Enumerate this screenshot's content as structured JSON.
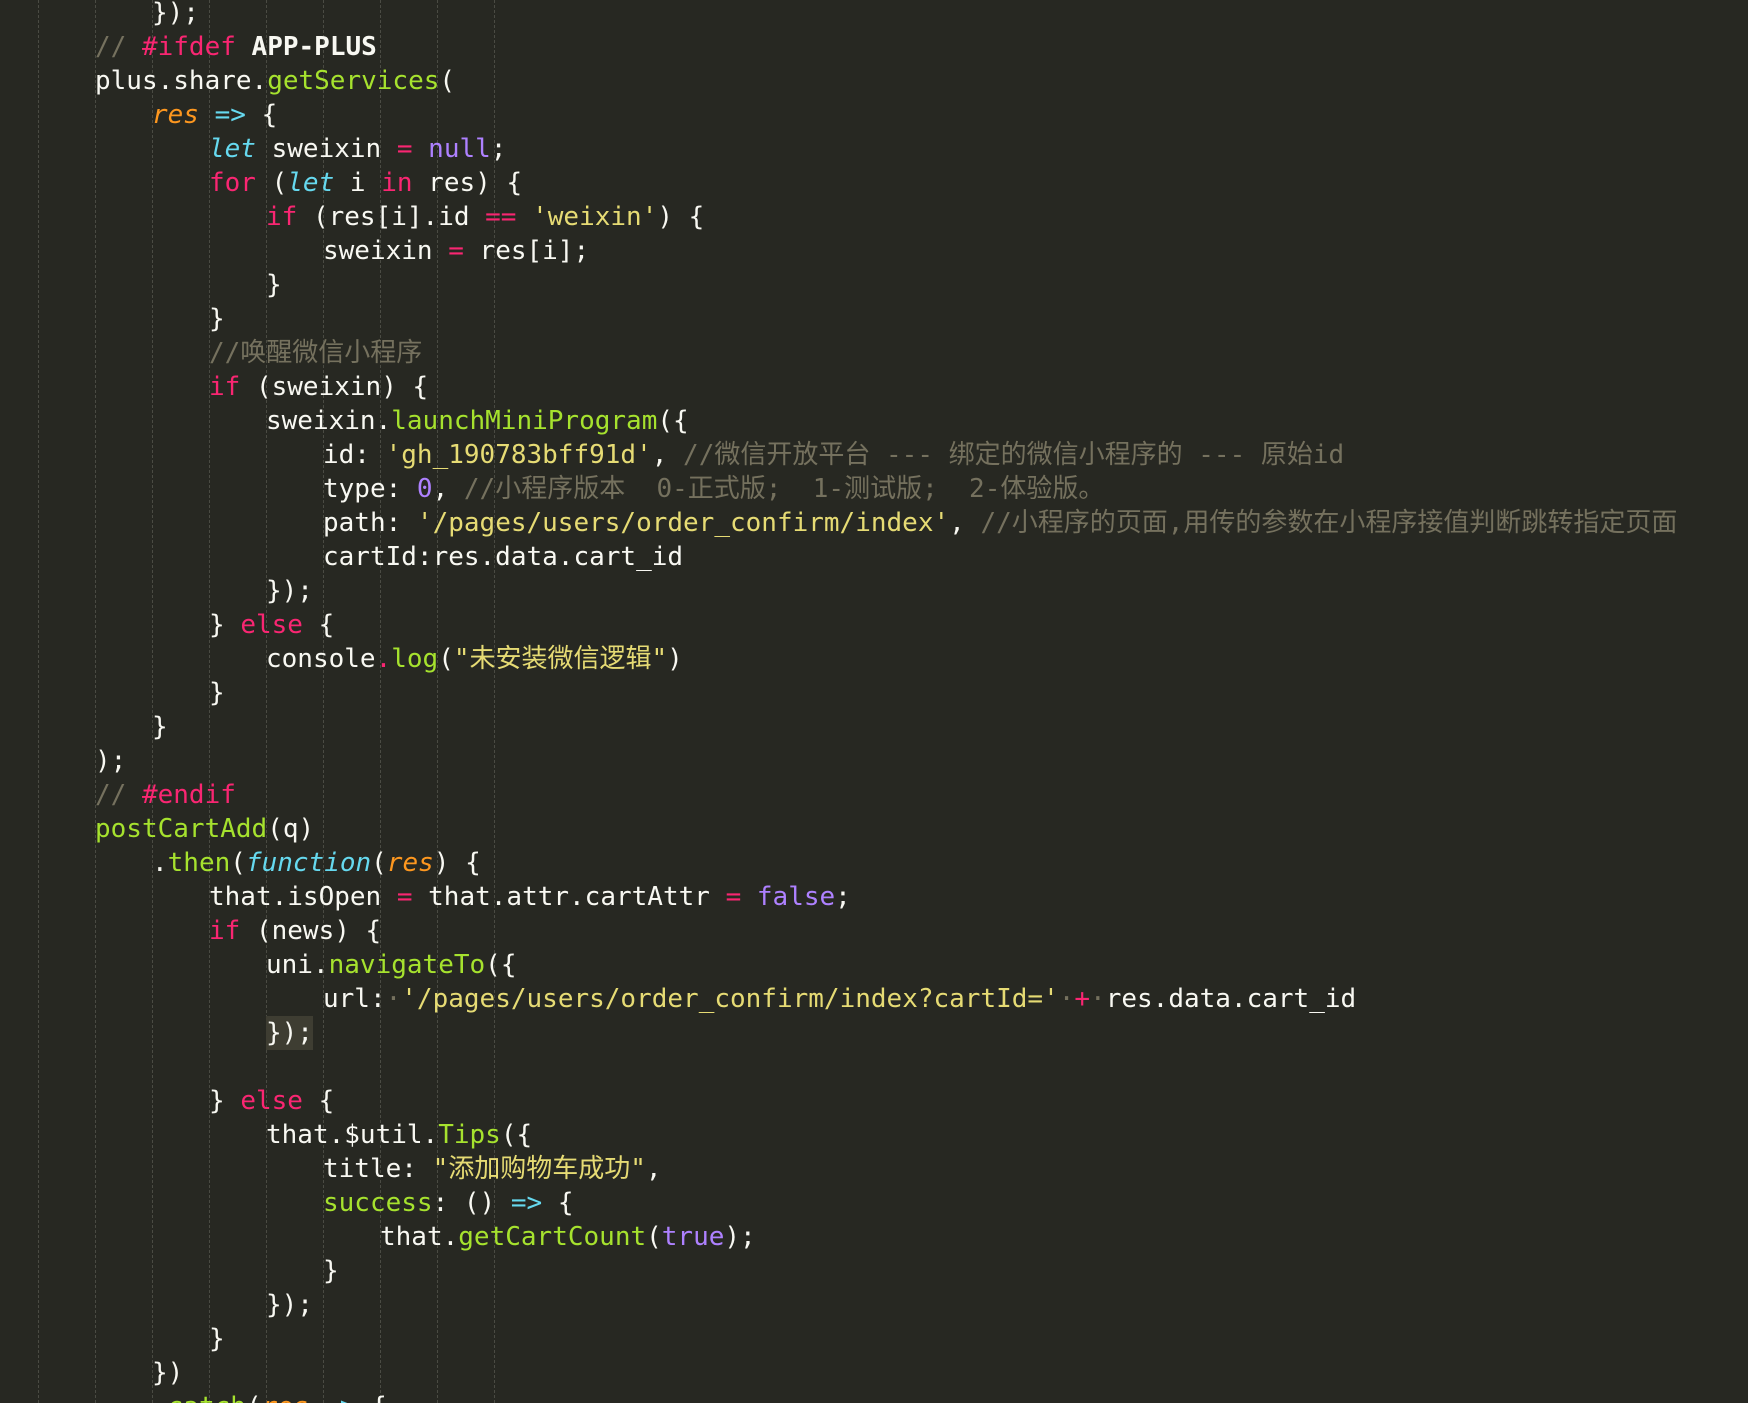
{
  "editor": {
    "theme": "monokai",
    "colors": {
      "background": "#272822",
      "plain": "#f8f8f2",
      "keyword": "#f92672",
      "storage": "#66d9ef",
      "param": "#fd971f",
      "function": "#a6e22e",
      "string": "#e6db74",
      "number": "#ae81ff",
      "comment": "#75715e",
      "highlight": "#3e3d32"
    },
    "highlighted_line": 30,
    "lines": [
      {
        "indent": 4,
        "tokens": [
          [
            "plain",
            "});"
          ]
        ]
      },
      {
        "indent": 3,
        "tokens": [
          [
            "comment",
            "// "
          ],
          [
            "directive",
            "#ifdef "
          ],
          [
            "bold",
            "APP-PLUS"
          ]
        ]
      },
      {
        "indent": 3,
        "tokens": [
          [
            "plain",
            "plus.share."
          ],
          [
            "func",
            "getServices"
          ],
          [
            "plain",
            "("
          ]
        ]
      },
      {
        "indent": 4,
        "tokens": [
          [
            "param",
            "res"
          ],
          [
            "plain",
            " "
          ],
          [
            "storage",
            "=>"
          ],
          [
            "plain",
            " {"
          ]
        ]
      },
      {
        "indent": 5,
        "tokens": [
          [
            "storage",
            "let"
          ],
          [
            "plain",
            " sweixin "
          ],
          [
            "op",
            "="
          ],
          [
            "plain",
            " "
          ],
          [
            "const",
            "null"
          ],
          [
            "plain",
            ";"
          ]
        ]
      },
      {
        "indent": 5,
        "tokens": [
          [
            "keyword",
            "for"
          ],
          [
            "plain",
            " ("
          ],
          [
            "storage",
            "let"
          ],
          [
            "plain",
            " i "
          ],
          [
            "keyword",
            "in"
          ],
          [
            "plain",
            " res) {"
          ]
        ]
      },
      {
        "indent": 6,
        "tokens": [
          [
            "keyword",
            "if"
          ],
          [
            "plain",
            " (res[i].id "
          ],
          [
            "op",
            "=="
          ],
          [
            "plain",
            " "
          ],
          [
            "string",
            "'weixin'"
          ],
          [
            "plain",
            ") {"
          ]
        ]
      },
      {
        "indent": 7,
        "tokens": [
          [
            "plain",
            "sweixin "
          ],
          [
            "op",
            "="
          ],
          [
            "plain",
            " res[i];"
          ]
        ]
      },
      {
        "indent": 6,
        "tokens": [
          [
            "plain",
            "}"
          ]
        ]
      },
      {
        "indent": 5,
        "tokens": [
          [
            "plain",
            "}"
          ]
        ]
      },
      {
        "indent": 5,
        "tokens": [
          [
            "comment",
            "//唤醒微信小程序"
          ]
        ]
      },
      {
        "indent": 5,
        "tokens": [
          [
            "keyword",
            "if"
          ],
          [
            "plain",
            " (sweixin) {"
          ]
        ]
      },
      {
        "indent": 6,
        "tokens": [
          [
            "plain",
            "sweixin."
          ],
          [
            "func",
            "launchMiniProgram"
          ],
          [
            "plain",
            "({"
          ]
        ]
      },
      {
        "indent": 7,
        "tokens": [
          [
            "plain",
            "id: "
          ],
          [
            "string",
            "'gh_190783bff91d'"
          ],
          [
            "plain",
            ", "
          ],
          [
            "comment",
            "//微信开放平台 --- 绑定的微信小程序的 --- 原始id"
          ]
        ]
      },
      {
        "indent": 7,
        "tokens": [
          [
            "plain",
            "type: "
          ],
          [
            "number",
            "0"
          ],
          [
            "plain",
            ", "
          ],
          [
            "comment",
            "//小程序版本  0-正式版;  1-测试版;  2-体验版。"
          ]
        ]
      },
      {
        "indent": 7,
        "tokens": [
          [
            "plain",
            "path: "
          ],
          [
            "string",
            "'/pages/users/order_confirm/index'"
          ],
          [
            "plain",
            ", "
          ],
          [
            "comment",
            "//小程序的页面,用传的参数在小程序接值判断跳转指定页面"
          ]
        ]
      },
      {
        "indent": 7,
        "tokens": [
          [
            "plain",
            "cartId:res.data.cart_id"
          ]
        ]
      },
      {
        "indent": 6,
        "tokens": [
          [
            "plain",
            "});"
          ]
        ]
      },
      {
        "indent": 5,
        "tokens": [
          [
            "plain",
            "} "
          ],
          [
            "keyword",
            "else"
          ],
          [
            "plain",
            " {"
          ]
        ]
      },
      {
        "indent": 6,
        "tokens": [
          [
            "plain",
            "console"
          ],
          [
            "op",
            "."
          ],
          [
            "func",
            "log"
          ],
          [
            "plain",
            "("
          ],
          [
            "string",
            "\"未安装微信逻辑\""
          ],
          [
            "plain",
            ")"
          ]
        ]
      },
      {
        "indent": 5,
        "tokens": [
          [
            "plain",
            "}"
          ]
        ]
      },
      {
        "indent": 4,
        "tokens": [
          [
            "plain",
            "}"
          ]
        ]
      },
      {
        "indent": 3,
        "tokens": [
          [
            "plain",
            ");"
          ]
        ]
      },
      {
        "indent": 3,
        "tokens": [
          [
            "comment",
            "// "
          ],
          [
            "directive",
            "#endif"
          ]
        ]
      },
      {
        "indent": 3,
        "tokens": [
          [
            "func",
            "postCartAdd"
          ],
          [
            "plain",
            "(q)"
          ]
        ]
      },
      {
        "indent": 4,
        "tokens": [
          [
            "plain",
            "."
          ],
          [
            "func",
            "then"
          ],
          [
            "plain",
            "("
          ],
          [
            "storage",
            "function"
          ],
          [
            "plain",
            "("
          ],
          [
            "param",
            "res"
          ],
          [
            "plain",
            ") {"
          ]
        ]
      },
      {
        "indent": 5,
        "tokens": [
          [
            "plain",
            "that.isOpen "
          ],
          [
            "op",
            "="
          ],
          [
            "plain",
            " that.attr.cartAttr "
          ],
          [
            "op",
            "="
          ],
          [
            "plain",
            " "
          ],
          [
            "const",
            "false"
          ],
          [
            "plain",
            ";"
          ]
        ]
      },
      {
        "indent": 5,
        "tokens": [
          [
            "keyword",
            "if"
          ],
          [
            "plain",
            " (news) {"
          ]
        ]
      },
      {
        "indent": 6,
        "tokens": [
          [
            "plain",
            "uni."
          ],
          [
            "func",
            "navigateTo"
          ],
          [
            "plain",
            "({"
          ]
        ]
      },
      {
        "indent": 7,
        "tokens": [
          [
            "plain",
            "url:"
          ],
          [
            "dot",
            "·"
          ],
          [
            "string",
            "'/pages/users/order_confirm/index?cartId='"
          ],
          [
            "dot",
            "·"
          ],
          [
            "op",
            "+"
          ],
          [
            "dot",
            "·"
          ],
          [
            "plain",
            "res.data.cart_id"
          ]
        ]
      },
      {
        "indent": 6,
        "tokens": [
          [
            "plain",
            "});"
          ]
        ]
      },
      {
        "indent": 6,
        "tokens": []
      },
      {
        "indent": 5,
        "tokens": [
          [
            "plain",
            "} "
          ],
          [
            "keyword",
            "else"
          ],
          [
            "plain",
            " {"
          ]
        ]
      },
      {
        "indent": 6,
        "tokens": [
          [
            "plain",
            "that.$util."
          ],
          [
            "func",
            "Tips"
          ],
          [
            "plain",
            "({"
          ]
        ]
      },
      {
        "indent": 7,
        "tokens": [
          [
            "plain",
            "title: "
          ],
          [
            "string",
            "\"添加购物车成功\""
          ],
          [
            "plain",
            ","
          ]
        ]
      },
      {
        "indent": 7,
        "tokens": [
          [
            "func",
            "success"
          ],
          [
            "plain",
            ": () "
          ],
          [
            "storage",
            "=>"
          ],
          [
            "plain",
            " {"
          ]
        ]
      },
      {
        "indent": 8,
        "tokens": [
          [
            "plain",
            "that."
          ],
          [
            "func",
            "getCartCount"
          ],
          [
            "plain",
            "("
          ],
          [
            "const",
            "true"
          ],
          [
            "plain",
            ");"
          ]
        ]
      },
      {
        "indent": 7,
        "tokens": [
          [
            "plain",
            "}"
          ]
        ]
      },
      {
        "indent": 6,
        "tokens": [
          [
            "plain",
            "});"
          ]
        ]
      },
      {
        "indent": 5,
        "tokens": [
          [
            "plain",
            "}"
          ]
        ]
      },
      {
        "indent": 4,
        "tokens": [
          [
            "plain",
            "})"
          ]
        ]
      },
      {
        "indent": 4,
        "tokens": [
          [
            "plain",
            "."
          ],
          [
            "func",
            "catch"
          ],
          [
            "plain",
            "("
          ],
          [
            "param",
            "res"
          ],
          [
            "plain",
            " "
          ],
          [
            "storage",
            "=>"
          ],
          [
            "plain",
            " {"
          ]
        ]
      }
    ]
  }
}
